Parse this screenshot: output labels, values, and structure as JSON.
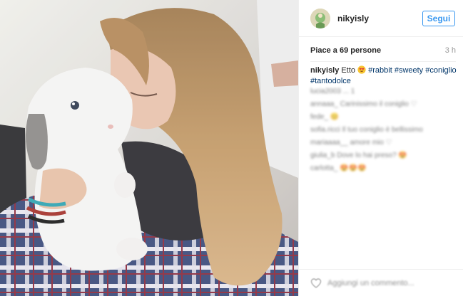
{
  "post": {
    "photo": {
      "subject": "girl hugging rabbit",
      "icon": "photo"
    },
    "header": {
      "username": "nikyisly",
      "follow_label": "Segui",
      "accent_color": "#3897f0"
    },
    "likes": "Piace a 69 persone",
    "time": "3 h",
    "caption": {
      "username": "nikyisly",
      "text": "Etto",
      "emoji": "heart-eyes",
      "hashtags": [
        "#rabbit",
        "#sweety",
        "#coniglio",
        "#tantodolce"
      ]
    },
    "comments": [
      "lucia2003 ... 1",
      "annaaa_ Carinissimo il coniglio ♡",
      "fede_ 😊",
      "sofia.ricci Il tuo coniglio è bellissimo",
      "mariaaaa__ amore mio ♡",
      "giulia_b Dove lo hai preso? 😍",
      "carlotta_ 😍😍😍"
    ],
    "comment_placeholder": "Aggiungi un commento..."
  }
}
